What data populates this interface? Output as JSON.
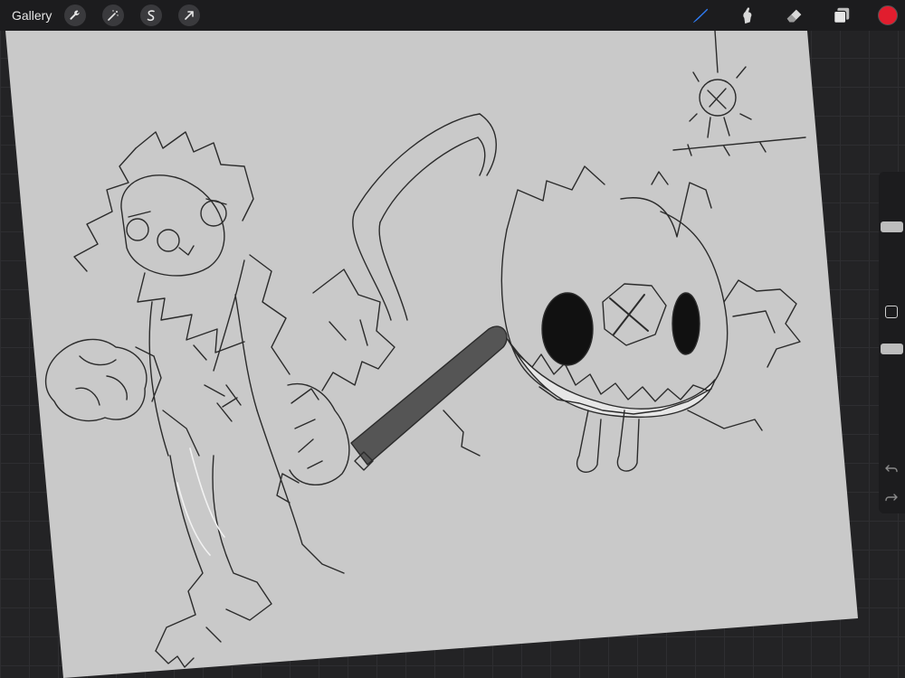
{
  "toolbar": {
    "gallery_label": "Gallery",
    "left_tools": [
      "wrench-icon",
      "magic-wand-icon",
      "selection-icon",
      "transform-icon"
    ],
    "right_tools": [
      "brush-icon",
      "smudge-icon",
      "eraser-icon",
      "layers-icon"
    ],
    "active_tool": "brush-icon",
    "active_color": "#e11d2e",
    "accent_color": "#2f7df6"
  },
  "sidebar": {
    "brush_size_level": 0.16,
    "opacity_level": 0.52
  }
}
